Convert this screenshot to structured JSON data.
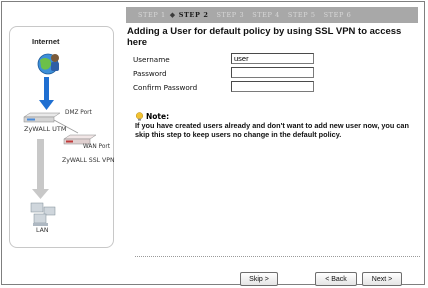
{
  "steps": {
    "items": [
      "STEP 1",
      "STEP 2",
      "STEP 3",
      "STEP 4",
      "STEP 5",
      "STEP 6"
    ],
    "active_index": 1,
    "active_marker_icon": "diamond-icon"
  },
  "diagram": {
    "internet_label": "Internet",
    "dmz_port_label": "DMZ Port",
    "utm_label": "ZyWALL UTM",
    "wan_port_label": "WAN Port",
    "sslvpn_label": "ZyWALL SSL VPN",
    "lan_label": "LAN"
  },
  "form": {
    "title": "Adding a User for default policy by using SSL VPN to access here",
    "username_label": "Username",
    "username_value": "user",
    "password_label": "Password",
    "password_value": "",
    "confirm_label": "Confirm Password",
    "confirm_value": ""
  },
  "note": {
    "heading": "Note:",
    "text": "If you have created users already and don't want to add new user now, you can skip this step to keep users no change in the default policy."
  },
  "buttons": {
    "skip": "Skip >",
    "back": "< Back",
    "next": "Next >"
  },
  "colors": {
    "stepbar_bg": "#a8a8a8",
    "arrow_blue": "#1f6fd1",
    "arrow_gray": "#c8c8c8"
  }
}
